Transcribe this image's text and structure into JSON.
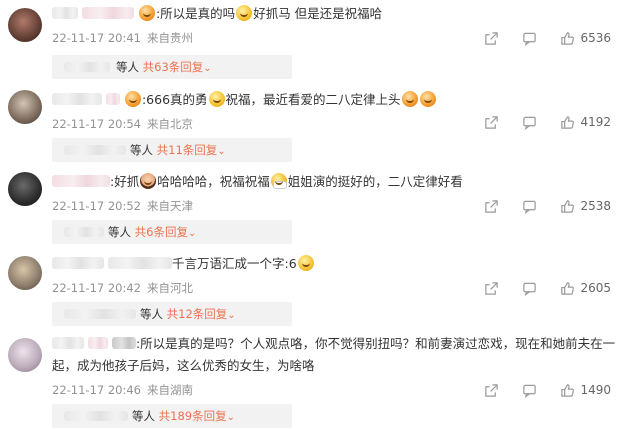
{
  "comments": [
    {
      "avatar_color": "#5a3a30",
      "text_parts": [
        ":所以是真的吗",
        "好抓马 但是还是祝福哈"
      ],
      "time": "22-11-17 20:41",
      "source": "来自贵州",
      "reply_prefix": "等人",
      "reply_count": "共63条回复",
      "likes": "6536"
    },
    {
      "avatar_color": "#7b6a5c",
      "text_parts": [
        ":666真的勇",
        "祝福，最近看爱的二八定律上头"
      ],
      "time": "22-11-17 20:54",
      "source": "来自北京",
      "reply_prefix": "等人",
      "reply_count": "共11条回复",
      "likes": "4192"
    },
    {
      "avatar_color": "#2c2c2c",
      "text_parts": [
        ":好抓",
        "哈哈哈哈，祝福祝福",
        "姐姐演的挺好的，二八定律好看"
      ],
      "time": "22-11-17 20:52",
      "source": "来自天津",
      "reply_prefix": "等人",
      "reply_count": "共6条回复",
      "likes": "2538"
    },
    {
      "avatar_color": "#8a7a6a",
      "text_parts": [
        "千言万语汇成一个字:6"
      ],
      "time": "22-11-17 20:42",
      "source": "来自河北",
      "reply_prefix": "等人",
      "reply_count": "共12条回复",
      "likes": "2605"
    },
    {
      "avatar_color": "#b9a9b6",
      "text_parts": [
        ":所以是真的是吗？个人观点咯，你不觉得别扭吗？和前妻演过恋戏，现在和她前夫在一",
        "起，成为他孩子后妈，这么优秀的女生，为啥咯"
      ],
      "time": "22-11-17 20:46",
      "source": "来自湖南",
      "reply_prefix": "等人",
      "reply_count": "共189条回复",
      "likes": "1490"
    }
  ],
  "icons": {
    "share": "share-icon",
    "comment": "comment-icon",
    "like": "thumbs-up-icon",
    "expand": "chevron-down-icon"
  },
  "colors": {
    "accent": "#eb7350",
    "meta": "#939393",
    "reply_bg": "#f2f2f2"
  }
}
